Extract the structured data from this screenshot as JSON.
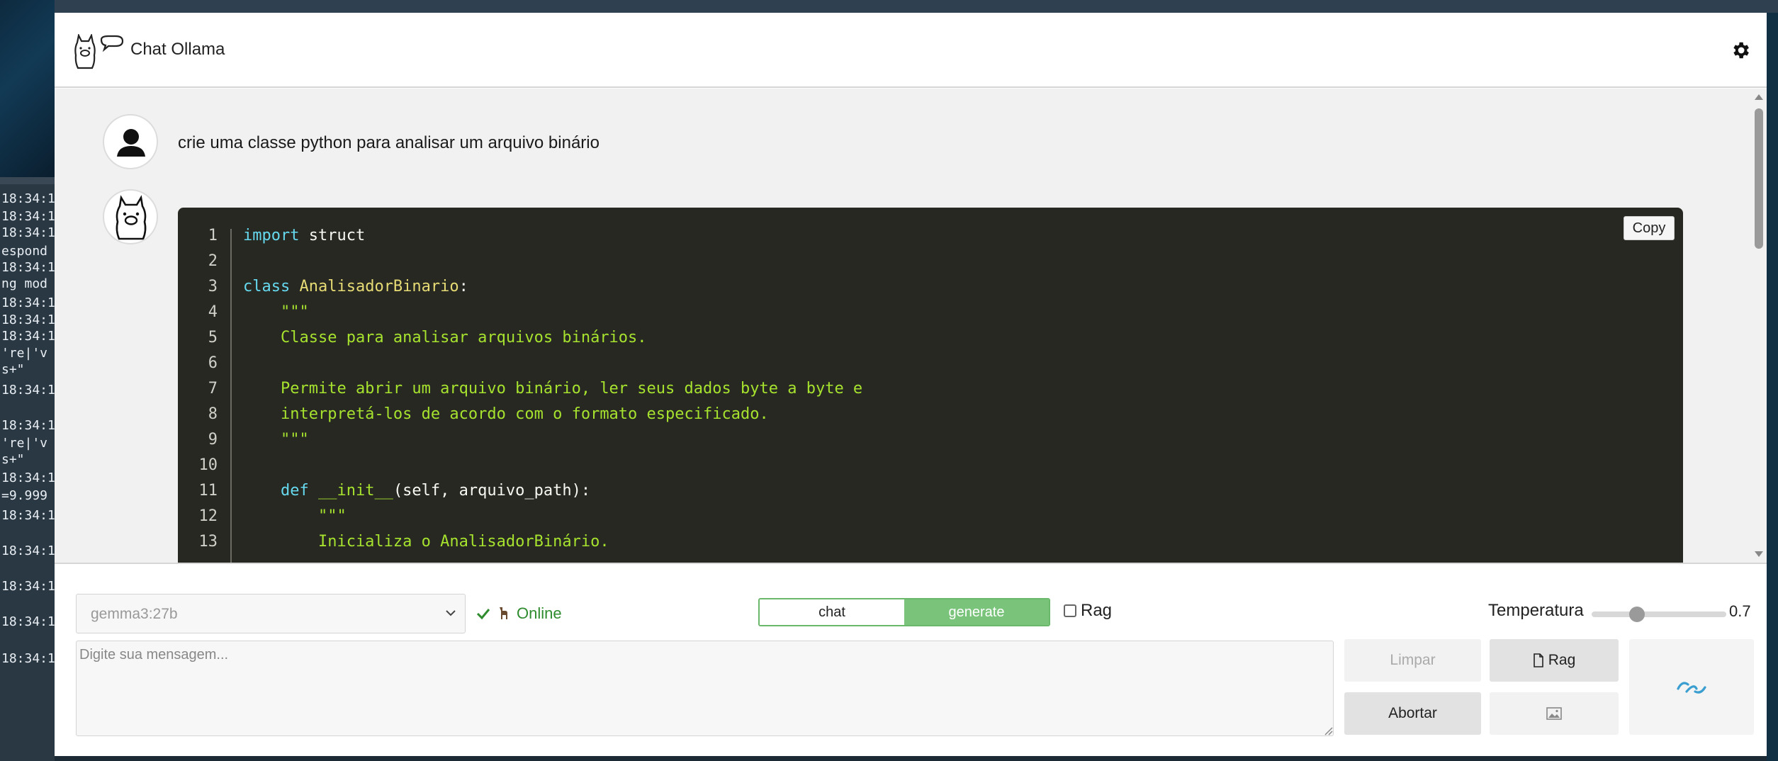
{
  "background_terminal": {
    "lines": [
      "18:34:1",
      "18:34:1",
      "18:34:1",
      "espond",
      "18:34:1",
      "ng mod",
      "18:34:1",
      "18:34:1",
      "18:34:1",
      "'re|'v",
      "s+\"",
      "18:34:1",
      "18:34:1",
      "'re|'v",
      "s+\"",
      "18:34:1",
      "=9.999",
      "18:34:1",
      "18:34:1",
      "18:34:1",
      "18:34:1",
      "18:34:1"
    ]
  },
  "header": {
    "title": "Chat Ollama",
    "logo_icon": "llama-chat-icon",
    "settings_icon": "gear-icon"
  },
  "chat": {
    "user_message": "crie uma classe python para analisar um arquivo binário",
    "code": {
      "copy_label": "Copy",
      "lines": [
        {
          "n": "1",
          "segments": [
            {
              "t": "import",
              "c": "kw"
            },
            {
              "t": " struct",
              "c": "plain"
            }
          ]
        },
        {
          "n": "2",
          "segments": []
        },
        {
          "n": "3",
          "segments": [
            {
              "t": "class",
              "c": "kw"
            },
            {
              "t": " ",
              "c": "plain"
            },
            {
              "t": "AnalisadorBinario",
              "c": "cls"
            },
            {
              "t": ":",
              "c": "plain"
            }
          ]
        },
        {
          "n": "4",
          "segments": [
            {
              "t": "    \"\"\"",
              "c": "str"
            }
          ]
        },
        {
          "n": "5",
          "segments": [
            {
              "t": "    Classe para analisar arquivos binários.",
              "c": "str"
            }
          ]
        },
        {
          "n": "6",
          "segments": []
        },
        {
          "n": "7",
          "segments": [
            {
              "t": "    Permite abrir um arquivo binário, ler seus dados byte a byte e",
              "c": "str"
            }
          ]
        },
        {
          "n": "8",
          "segments": [
            {
              "t": "    interpretá-los de acordo com o formato especificado.",
              "c": "str"
            }
          ]
        },
        {
          "n": "9",
          "segments": [
            {
              "t": "    \"\"\"",
              "c": "str"
            }
          ]
        },
        {
          "n": "10",
          "segments": []
        },
        {
          "n": "11",
          "segments": [
            {
              "t": "    def",
              "c": "kw"
            },
            {
              "t": " ",
              "c": "plain"
            },
            {
              "t": "__init__",
              "c": "str"
            },
            {
              "t": "(self, arquivo_path):",
              "c": "plain"
            }
          ]
        },
        {
          "n": "12",
          "segments": [
            {
              "t": "        \"\"\"",
              "c": "str"
            }
          ]
        },
        {
          "n": "13",
          "segments": [
            {
              "t": "        Inicializa o AnalisadorBinário.",
              "c": "str"
            }
          ]
        }
      ]
    }
  },
  "controls": {
    "model": "gemma3:27b",
    "status_text": "Online",
    "mode_tabs": [
      "chat",
      "generate"
    ],
    "rag_checkbox_label": "Rag",
    "rag_checked": false,
    "temperature_label": "Temperatura",
    "temperature_value": "0.7",
    "temperature_fraction": 0.7,
    "message_placeholder": "Digite sua mensagem...",
    "buttons": {
      "limpar": "Limpar",
      "rag": "Rag",
      "abortar": "Abortar"
    }
  },
  "colors": {
    "accent_green": "#79c47a",
    "status_green": "#2e8b2e",
    "code_bg": "#272822",
    "send_icon": "#3a9fd0"
  }
}
